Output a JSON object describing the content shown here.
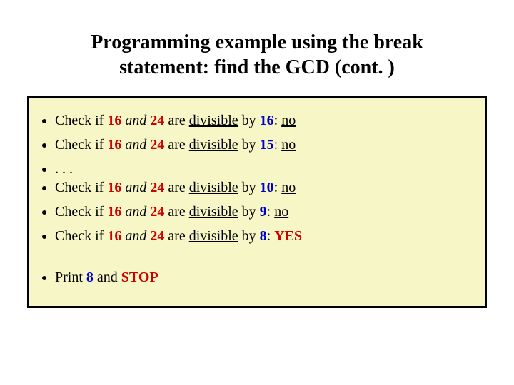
{
  "title_line1": "Programming example using the break",
  "title_line2": "statement: find the GCD (cont. )",
  "word": {
    "check_if": "Check if ",
    "and": "and",
    "are": " are ",
    "divisible": "divisible",
    "by": " by ",
    "colon_sp": ": ",
    "no": "no",
    "yes": "YES",
    "ellipsis": ". . .",
    "print": "Print ",
    "and2": " and ",
    "stop": "STOP"
  },
  "nums": {
    "a": "16",
    "b": "24",
    "d16": "16",
    "d15": "15",
    "d10": "10",
    "d9": "9",
    "d8": "8",
    "gcd": "8"
  }
}
